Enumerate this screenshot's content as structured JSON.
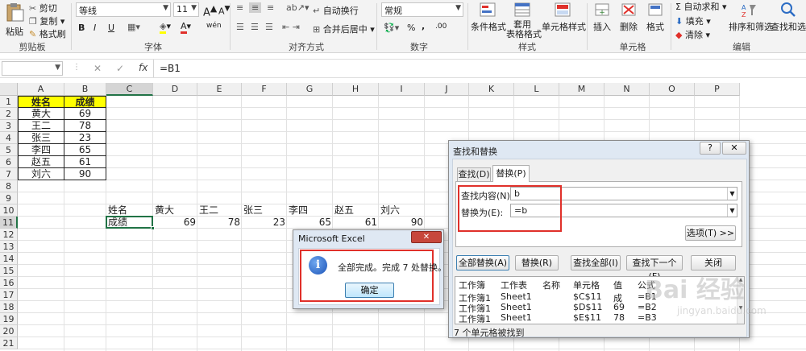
{
  "ribbon": {
    "clipboard": {
      "paste": "粘贴",
      "cut": "剪切",
      "copy": "复制",
      "format_painter": "格式刷",
      "label": "剪贴板"
    },
    "font": {
      "name": "等线",
      "size": "11",
      "label": "字体",
      "grow": "A",
      "shrink": "A",
      "bold": "B",
      "italic": "I",
      "underline": "U",
      "wen": "wén"
    },
    "alignment": {
      "wrap": "自动换行",
      "merge": "合并后居中",
      "label": "对齐方式"
    },
    "number": {
      "format": "常规",
      "percent": "%",
      "comma": ",",
      "dec_inc": ".00",
      "label": "数字"
    },
    "styles": {
      "cond": "条件格式",
      "table": "套用\n表格格式",
      "cell": "单元格样式",
      "label": "样式"
    },
    "cells": {
      "insert": "插入",
      "delete": "删除",
      "format": "格式",
      "label": "单元格"
    },
    "editing": {
      "autosum": "自动求和",
      "fill": "填充",
      "clear": "清除",
      "sort": "排序和筛选",
      "find": "查找和选择",
      "label": "编辑"
    }
  },
  "formula_bar": {
    "name_box": "",
    "cancel": "✕",
    "enter": "✓",
    "fx": "fx",
    "formula": "=B1"
  },
  "columns": [
    "A",
    "B",
    "C",
    "D",
    "E",
    "F",
    "G",
    "H",
    "I",
    "J",
    "K",
    "L",
    "M",
    "N",
    "O",
    "P"
  ],
  "rows": [
    "1",
    "2",
    "3",
    "4",
    "5",
    "6",
    "7",
    "8",
    "9",
    "10",
    "11",
    "12",
    "13",
    "14",
    "15",
    "16",
    "17",
    "18",
    "19",
    "20",
    "21"
  ],
  "table1": {
    "header": [
      "姓名",
      "成绩"
    ],
    "rows": [
      [
        "黄大",
        "69"
      ],
      [
        "王二",
        "78"
      ],
      [
        "张三",
        "23"
      ],
      [
        "李四",
        "65"
      ],
      [
        "赵五",
        "61"
      ],
      [
        "刘六",
        "90"
      ]
    ]
  },
  "row10": [
    "姓名",
    "黄大",
    "王二",
    "张三",
    "李四",
    "赵五",
    "刘六"
  ],
  "row11": [
    "成绩",
    "69",
    "78",
    "23",
    "65",
    "61",
    "90"
  ],
  "alert": {
    "title": "Microsoft Excel",
    "message": "全部完成。完成 7 处替换。",
    "ok": "确定",
    "close": "✕"
  },
  "find_replace": {
    "title": "查找和替换",
    "help": "?",
    "close": "✕",
    "tab_find": "查找(D)",
    "tab_replace": "替换(P)",
    "find_label": "查找内容(N):",
    "find_value": "b",
    "replace_label": "替换为(E):",
    "replace_value": "=b",
    "options": "选项(T) >>",
    "replace_all": "全部替换(A)",
    "replace": "替换(R)",
    "find_all": "查找全部(I)",
    "find_next": "查找下一个(F)",
    "close_btn": "关闭",
    "result_headers": [
      "工作簿",
      "工作表",
      "名称",
      "单元格",
      "值",
      "公式"
    ],
    "results": [
      [
        "工作簿1",
        "Sheet1",
        "",
        "$C$11",
        "成",
        "=B1"
      ],
      [
        "工作簿1",
        "Sheet1",
        "",
        "$D$11",
        "69",
        "=B2"
      ],
      [
        "工作簿1",
        "Sheet1",
        "",
        "$E$11",
        "78",
        "=B3"
      ]
    ],
    "status": "7 个单元格被找到"
  },
  "watermark": {
    "text": "Bai 经验",
    "sub": "jingyan.baidu.com"
  }
}
